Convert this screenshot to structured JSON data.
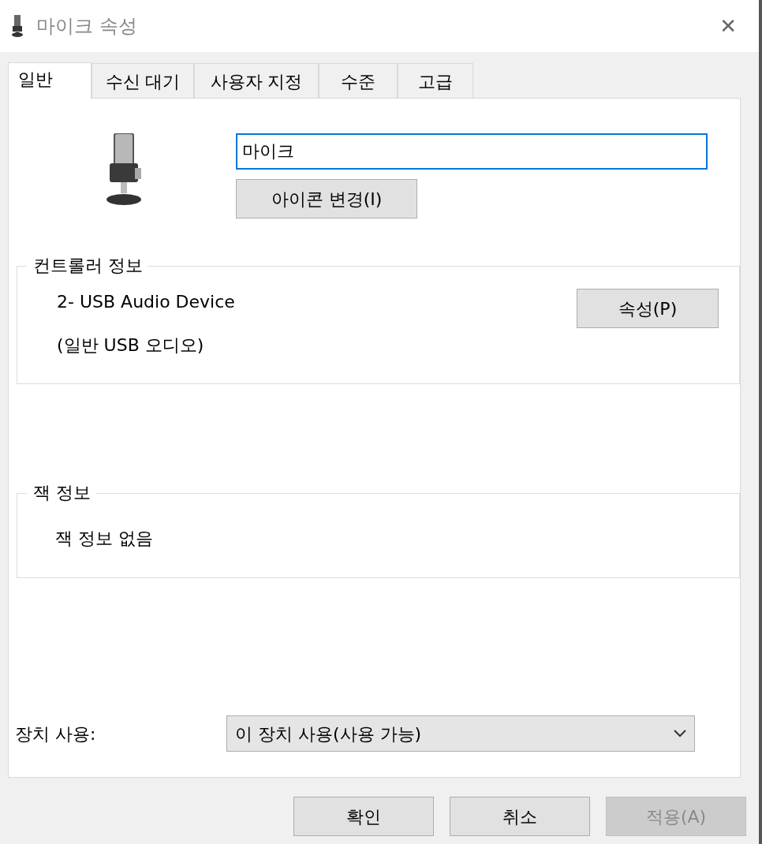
{
  "window": {
    "title": "마이크 속성",
    "close": "✕"
  },
  "tabs": [
    {
      "label": "일반",
      "selected": true
    },
    {
      "label": "수신 대기",
      "selected": false
    },
    {
      "label": "사용자 지정",
      "selected": false
    },
    {
      "label": "수준",
      "selected": false
    },
    {
      "label": "고급",
      "selected": false
    }
  ],
  "name_field": {
    "value": "마이크"
  },
  "change_icon_button": {
    "label": "아이콘 변경(I)"
  },
  "controller_info": {
    "title": "컨트롤러 정보",
    "lines": [
      "2- USB Audio Device",
      "(일반 USB 오디오)"
    ],
    "button": "속성(P)"
  },
  "jack_info": {
    "title": "잭 정보",
    "text": "잭 정보 없음"
  },
  "device_usage": {
    "label": "장치 사용:",
    "value": "이 장치 사용(사용 가능)"
  },
  "buttons": [
    {
      "label": "확인",
      "disabled": false
    },
    {
      "label": "취소",
      "disabled": false
    },
    {
      "label": "적용(A)",
      "disabled": true
    }
  ]
}
